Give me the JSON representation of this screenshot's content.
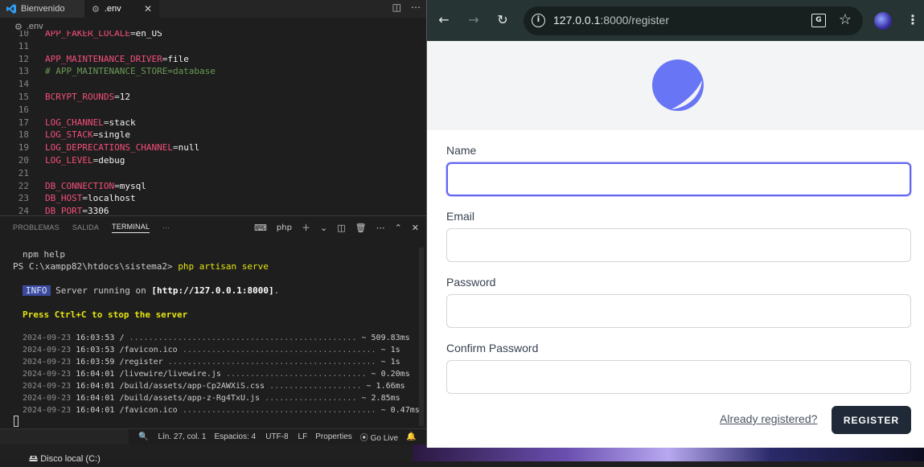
{
  "vscode": {
    "tabs": [
      {
        "label": "Bienvenido",
        "icon": "vscode-icon"
      },
      {
        "label": ".env",
        "icon": "gear-icon"
      }
    ],
    "breadcrumb": ".env",
    "editor_lines": [
      {
        "n": "10",
        "key": "APP_FAKER_LOCALE",
        "val": "en_US"
      },
      {
        "n": "11",
        "key": "",
        "val": ""
      },
      {
        "n": "12",
        "key": "APP_MAINTENANCE_DRIVER",
        "val": "file"
      },
      {
        "n": "13",
        "comment": "# APP_MAINTENANCE_STORE=database"
      },
      {
        "n": "14",
        "key": "",
        "val": ""
      },
      {
        "n": "15",
        "key": "BCRYPT_ROUNDS",
        "val": "12"
      },
      {
        "n": "16",
        "key": "",
        "val": ""
      },
      {
        "n": "17",
        "key": "LOG_CHANNEL",
        "val": "stack"
      },
      {
        "n": "18",
        "key": "LOG_STACK",
        "val": "single"
      },
      {
        "n": "19",
        "key": "LOG_DEPRECATIONS_CHANNEL",
        "val": "null"
      },
      {
        "n": "20",
        "key": "LOG_LEVEL",
        "val": "debug"
      },
      {
        "n": "21",
        "key": "",
        "val": ""
      },
      {
        "n": "22",
        "key": "DB_CONNECTION",
        "val": "mysql"
      },
      {
        "n": "23",
        "key": "DB_HOST",
        "val": "localhost"
      },
      {
        "n": "24",
        "key": "DB_PORT",
        "val": "3306"
      }
    ],
    "panel_tabs": [
      "PROBLEMAS",
      "SALIDA",
      "TERMINAL"
    ],
    "active_panel_tab": "TERMINAL",
    "terminal_profile": "php",
    "terminal": {
      "npm_help": "npm help",
      "prompt": "PS C:\\xampp82\\htdocs\\sistema2>",
      "command": "php artisan serve",
      "info_badge": "INFO",
      "info_text": "Server running on",
      "info_url": "[http://127.0.0.1:8000]",
      "info_end": ".",
      "stop_hint": "Press Ctrl+C to stop the server",
      "log": [
        {
          "date": "2024-09-23",
          "time": "16:03:53",
          "path": "/ ",
          "dots": "...............................................",
          "dur": "~ 509.83ms"
        },
        {
          "date": "2024-09-23",
          "time": "16:03:53",
          "path": "/favicon.ico ",
          "dots": "........................................",
          "dur": "~ 1s"
        },
        {
          "date": "2024-09-23",
          "time": "16:03:59",
          "path": "/register ",
          "dots": "...........................................",
          "dur": "~ 1s"
        },
        {
          "date": "2024-09-23",
          "time": "16:04:01",
          "path": "/livewire/livewire.js ",
          "dots": ".............................",
          "dur": "~ 0.20ms"
        },
        {
          "date": "2024-09-23",
          "time": "16:04:01",
          "path": "/build/assets/app-Cp2AWXiS.css ",
          "dots": "...................",
          "dur": "~ 1.66ms"
        },
        {
          "date": "2024-09-23",
          "time": "16:04:01",
          "path": "/build/assets/app-z-Rg4TxU.js ",
          "dots": "...................",
          "dur": "~ 2.85ms"
        },
        {
          "date": "2024-09-23",
          "time": "16:04:01",
          "path": "/favicon.ico ",
          "dots": "........................................",
          "dur": "~ 0.47ms"
        }
      ]
    },
    "statusbar": {
      "position": "Lín. 27, col. 1",
      "spaces": "Espacios: 4",
      "encoding": "UTF-8",
      "eol": "LF",
      "language": "Properties",
      "golive": "Go Live"
    },
    "taskbar_item": "Disco local (C:)"
  },
  "browser": {
    "url_host": "127.0.0.1",
    "url_rest": ":8000/register",
    "form": {
      "name_label": "Name",
      "email_label": "Email",
      "password_label": "Password",
      "confirm_label": "Confirm Password",
      "name_value": "",
      "email_value": "",
      "password_value": "",
      "confirm_value": "",
      "already_link": "Already registered?",
      "register_button": "REGISTER"
    },
    "accent_color": "#6366f1",
    "logo_color": "#6875f5"
  }
}
